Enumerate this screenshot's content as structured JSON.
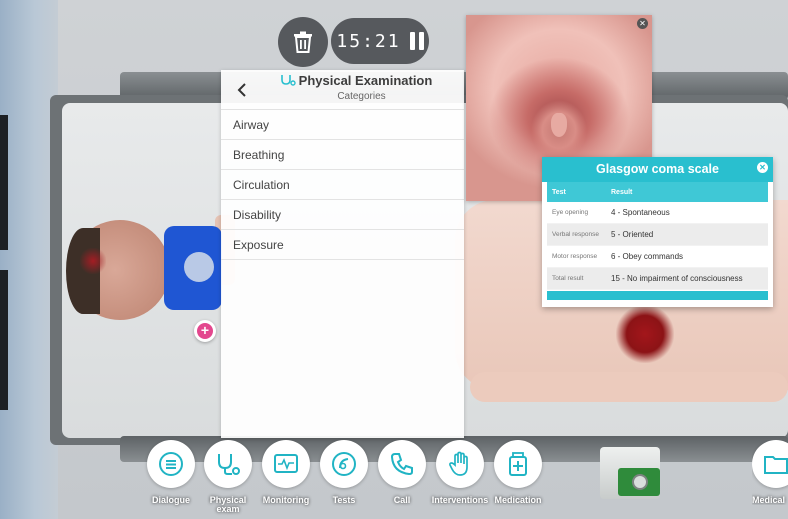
{
  "timer": {
    "time": "15:21"
  },
  "exam_panel": {
    "title": "Physical Examination",
    "subtitle": "Categories",
    "categories": [
      {
        "label": "Airway"
      },
      {
        "label": "Breathing"
      },
      {
        "label": "Circulation"
      },
      {
        "label": "Disability"
      },
      {
        "label": "Exposure"
      }
    ]
  },
  "gcs": {
    "title": "Glasgow coma scale",
    "header": {
      "test": "Test",
      "result": "Result"
    },
    "rows": [
      {
        "test": "Eye opening",
        "result": "4 - Spontaneous"
      },
      {
        "test": "Verbal response",
        "result": "5 -  Oriented"
      },
      {
        "test": "Motor response",
        "result": "6 - Obey commands"
      },
      {
        "test": "Total result",
        "result": "15 - No impairment of consciousness"
      }
    ]
  },
  "toolbar": [
    {
      "label": "Dialogue",
      "icon": "dialogue-icon"
    },
    {
      "label": "Physical exam",
      "icon": "stethoscope-icon"
    },
    {
      "label": "Monitoring",
      "icon": "monitor-icon"
    },
    {
      "label": "Tests",
      "icon": "tests-icon"
    },
    {
      "label": "Call",
      "icon": "phone-icon"
    },
    {
      "label": "Interventions",
      "icon": "hand-icon"
    },
    {
      "label": "Medication",
      "icon": "medication-icon"
    },
    {
      "label": "Medical",
      "icon": "folder-icon"
    }
  ],
  "colors": {
    "accent": "#29bfcf",
    "tool_icon": "#21b4c4",
    "add_marker": "#e3478e",
    "panel": "#ffffff"
  }
}
